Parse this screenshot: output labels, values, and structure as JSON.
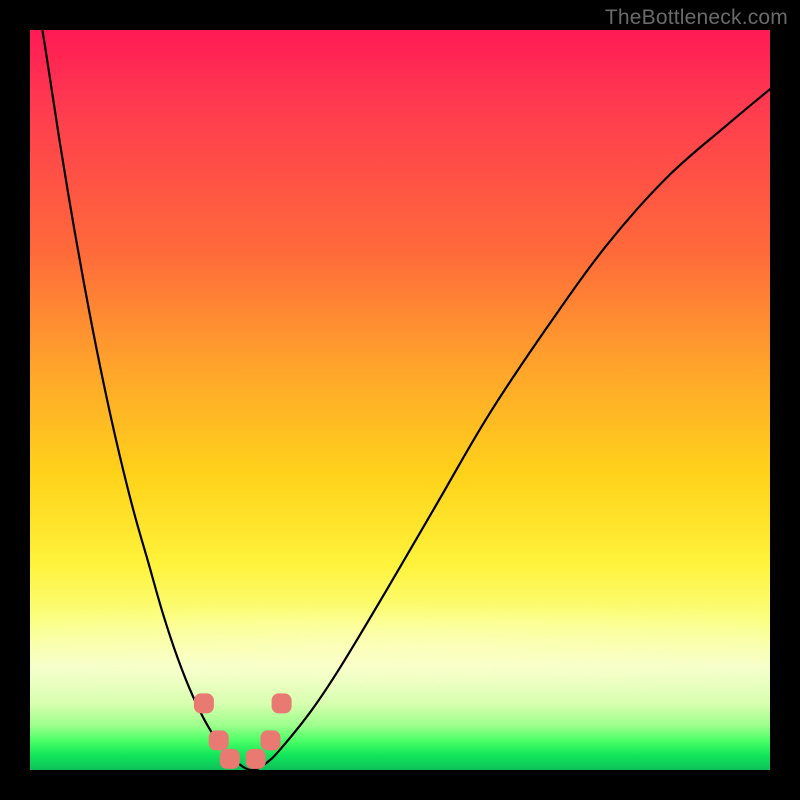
{
  "watermark": "TheBottleneck.com",
  "chart_data": {
    "type": "line",
    "title": "",
    "xlabel": "",
    "ylabel": "",
    "xlim": [
      0,
      100
    ],
    "ylim": [
      0,
      100
    ],
    "grid": false,
    "series": [
      {
        "name": "bottleneck-curve",
        "x": [
          0,
          2,
          4,
          6,
          8,
          10,
          12,
          14,
          16,
          18,
          20,
          22,
          24,
          26,
          28,
          30,
          32,
          34,
          38,
          42,
          48,
          55,
          62,
          70,
          78,
          86,
          94,
          100
        ],
        "values": [
          110,
          98,
          85,
          73,
          62,
          52,
          43,
          35,
          28,
          21,
          15,
          10,
          6,
          3,
          1,
          0,
          1,
          3,
          8,
          14,
          24,
          36,
          48,
          60,
          71,
          80,
          87,
          92
        ]
      }
    ],
    "markers": {
      "name": "bottleneck-optimal-band",
      "x": [
        23.5,
        25.5,
        27.0,
        30.5,
        32.5,
        34.0
      ],
      "values": [
        9.0,
        4.0,
        1.5,
        1.5,
        4.0,
        9.0
      ]
    },
    "background_gradient": {
      "stops": [
        {
          "pos": 0.0,
          "color": "#ff1a55"
        },
        {
          "pos": 0.3,
          "color": "#ff6a3a"
        },
        {
          "pos": 0.6,
          "color": "#ffd21a"
        },
        {
          "pos": 0.85,
          "color": "#f5ffcc"
        },
        {
          "pos": 1.0,
          "color": "#0dbf5a"
        }
      ]
    }
  }
}
